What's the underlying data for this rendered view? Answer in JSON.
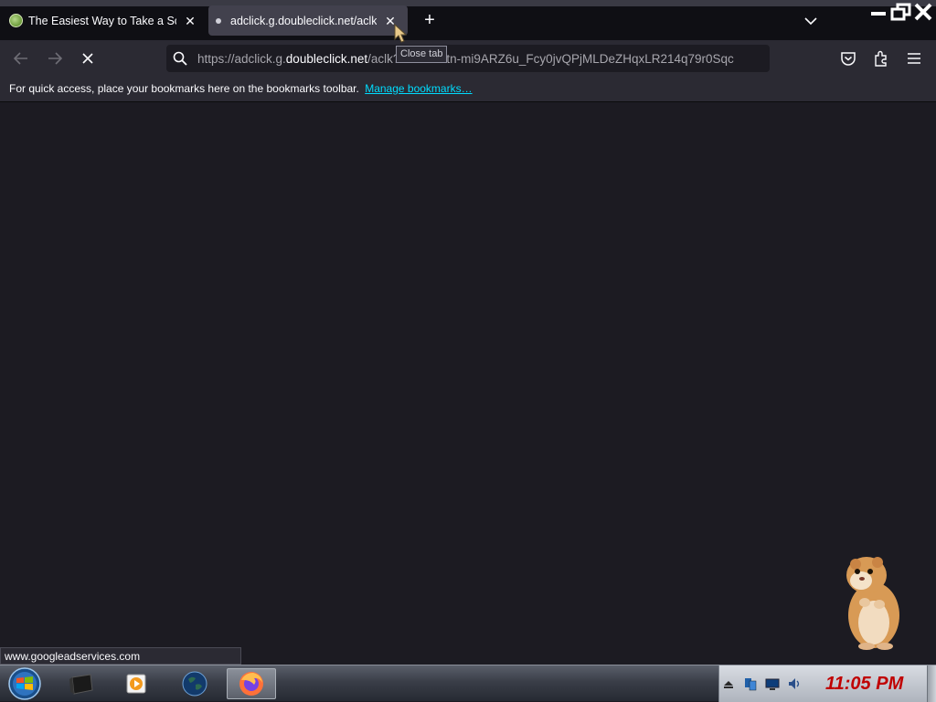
{
  "browser": {
    "tabs": [
      {
        "title": "The Easiest Way to Take a Sc",
        "favicon": "site-favicon-icon",
        "active": false
      },
      {
        "title": "adclick.g.doubleclick.net/aclk",
        "favicon": "loading-dot-icon",
        "active": true
      }
    ],
    "tooltip": "Close tab",
    "url": {
      "prefix": "https://adclick.g.",
      "host": "doubleclick.net",
      "rest": "/aclk?sa=...=Ctn-mi9ARZ6u_Fcy0jvQPjMLDeZHqxLR214q79r0Sqc"
    },
    "bookmarks_bar": {
      "message": "For quick access, place your bookmarks here on the bookmarks toolbar.",
      "link": "Manage bookmarks…"
    },
    "status_url": "www.googleadservices.com"
  },
  "taskbar": {
    "apps": [
      "terminal-icon",
      "media-player-icon",
      "globe-icon",
      "firefox-icon"
    ],
    "active_app": "firefox-icon",
    "clock": "11:05 PM"
  },
  "colors": {
    "accent_link": "#00ddff",
    "clock": "#c00000",
    "content_bg": "#1c1b22"
  }
}
